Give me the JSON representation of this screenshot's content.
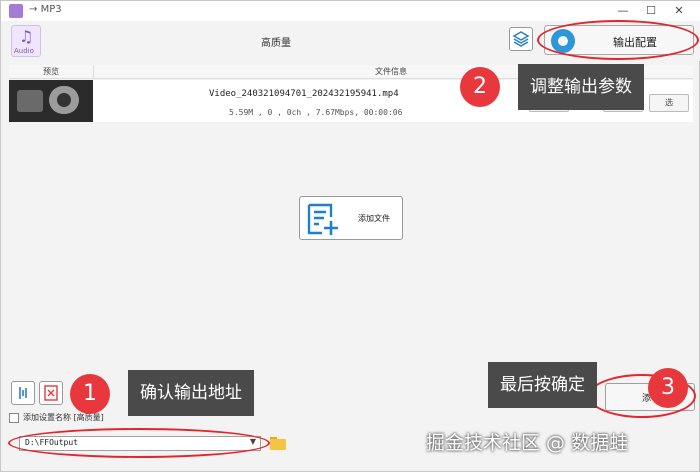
{
  "window": {
    "title": "MP3",
    "min_label": "—",
    "max_label": "☐",
    "close_label": "✕"
  },
  "toolbar": {
    "audio_icon_label": "Audio",
    "quality": "高质量",
    "config_label": "输出配置"
  },
  "table": {
    "columns": [
      "预览",
      "文件信息"
    ],
    "rows": [
      {
        "filename": "Video_240321094701_202432195941.mp4",
        "meta": "5.59M , 0 , 0ch , 7.67Mbps, 00:00:06",
        "actions": [
          "分割",
          "",
          "选"
        ]
      }
    ]
  },
  "add_file": {
    "label": "添加文件"
  },
  "bottom": {
    "checkbox_label": "添加设置名称 [高质量]",
    "output_path": "D:\\FFOutput",
    "start_label": "添"
  },
  "annotations": [
    {
      "number": "1",
      "text": "确认输出地址"
    },
    {
      "number": "2",
      "text": "调整输出参数"
    },
    {
      "number": "3",
      "text": "最后按确定"
    }
  ],
  "watermark": "掘金技术社区 @ 数据蛙",
  "colors": {
    "accent_red": "#e8383d",
    "callout_bg": "#4a4a4a",
    "gear_blue": "#2e97d8",
    "audio_purple": "#7f55c8"
  }
}
